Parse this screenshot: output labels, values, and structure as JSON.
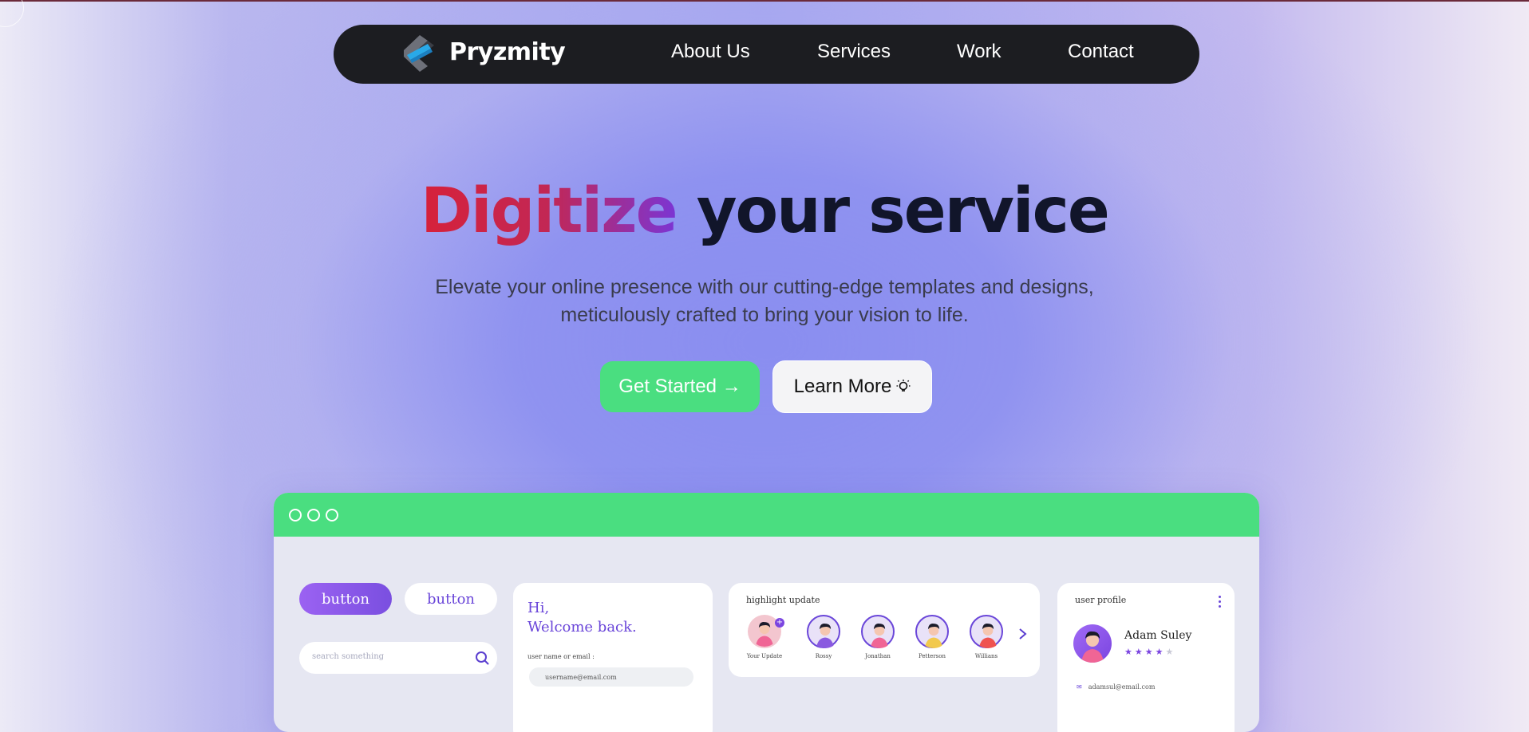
{
  "nav": {
    "brand": "Pryzmity",
    "links": [
      "About Us",
      "Services",
      "Work",
      "Contact"
    ]
  },
  "hero": {
    "title_highlight": "Digitize",
    "title_rest": " your service",
    "subtitle_line1": "Elevate your online presence with our cutting-edge templates and designs,",
    "subtitle_line2": "meticulously crafted to bring your vision to life.",
    "primary_cta": "Get Started →",
    "secondary_cta": "Learn More",
    "secondary_cta_icon": "lightbulb-icon"
  },
  "mockup": {
    "button_filled": "button",
    "button_outline": "button",
    "search_placeholder": "search something",
    "login": {
      "greeting_line1": "Hi,",
      "greeting_line2": "Welcome back.",
      "field_label": "user name or email :",
      "field_value": "username@email.com"
    },
    "highlight": {
      "title": "highlight update",
      "stories": [
        {
          "name": "Your Update",
          "ring": "#f3c6cf",
          "shirt": "#f06595"
        },
        {
          "name": "Rossy",
          "ring": "#6a46d9",
          "shirt": "#8a5ae0"
        },
        {
          "name": "Jonathan",
          "ring": "#6a46d9",
          "shirt": "#f06595"
        },
        {
          "name": "Petterson",
          "ring": "#6a46d9",
          "shirt": "#f2c94c"
        },
        {
          "name": "Willians",
          "ring": "#6a46d9",
          "shirt": "#ef5350"
        }
      ]
    },
    "profile": {
      "title": "user profile",
      "name": "Adam Suley",
      "rating": 4,
      "max_rating": 5,
      "email": "adamsul@email.com"
    }
  },
  "colors": {
    "nav_bg": "#1c1d21",
    "accent_green": "#4ade80",
    "accent_purple": "#6a46d9",
    "title_red": "#d6213a",
    "title_dark": "#11152a"
  }
}
